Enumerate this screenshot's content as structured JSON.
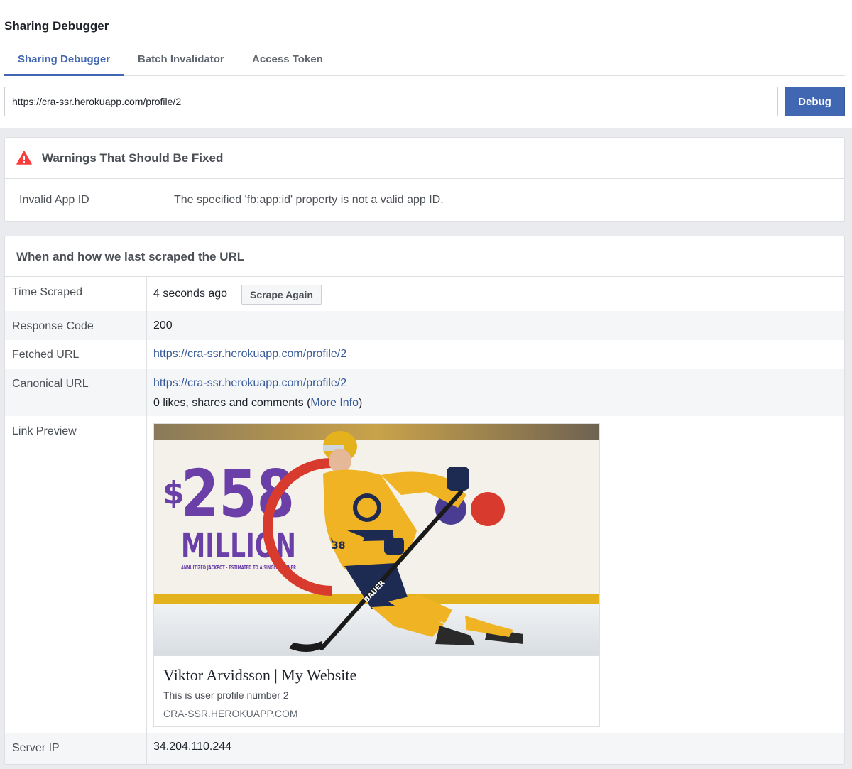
{
  "page": {
    "title": "Sharing Debugger"
  },
  "tabs": [
    {
      "label": "Sharing Debugger",
      "active": true
    },
    {
      "label": "Batch Invalidator",
      "active": false
    },
    {
      "label": "Access Token",
      "active": false
    }
  ],
  "url_bar": {
    "value": "https://cra-ssr.herokuapp.com/profile/2",
    "button_label": "Debug"
  },
  "warnings": {
    "title": "Warnings That Should Be Fixed",
    "icon": "warning-triangle-icon",
    "items": [
      {
        "label": "Invalid App ID",
        "message": "The specified 'fb:app:id' property is not a valid app ID."
      }
    ]
  },
  "scrape": {
    "title": "When and how we last scraped the URL",
    "time_scraped": {
      "label": "Time Scraped",
      "value": "4 seconds ago",
      "button_label": "Scrape Again"
    },
    "response_code": {
      "label": "Response Code",
      "value": "200"
    },
    "fetched_url": {
      "label": "Fetched URL",
      "value": "https://cra-ssr.herokuapp.com/profile/2"
    },
    "canonical_url": {
      "label": "Canonical URL",
      "value": "https://cra-ssr.herokuapp.com/profile/2",
      "engagement_prefix": "0 likes, shares and comments (",
      "more_info": "More Info",
      "engagement_suffix": ")"
    },
    "link_preview": {
      "label": "Link Preview",
      "image": {
        "ad_dollar": "$",
        "ad_amount": "258",
        "ad_word": "MILLION",
        "ad_fine_print": "ANNUITIZED JACKPOT · ESTIMATED TO A SINGLE WINNER",
        "jersey_number": "38",
        "stick_brand": "BAUER"
      },
      "title": "Viktor Arvidsson | My Website",
      "description": "This is user profile number 2",
      "domain": "CRA-SSR.HEROKUAPP.COM"
    },
    "server_ip": {
      "label": "Server IP",
      "value": "34.204.110.244"
    }
  }
}
